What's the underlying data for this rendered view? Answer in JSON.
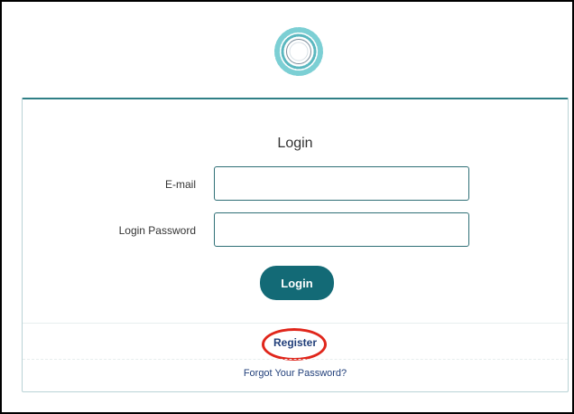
{
  "header": {
    "logo_icon": "circular-logo-icon"
  },
  "login": {
    "title": "Login",
    "email_label": "E-mail",
    "email_value": "",
    "password_label": "Login Password",
    "password_value": "",
    "submit_label": "Login"
  },
  "links": {
    "register": "Register",
    "forgot_password": "Forgot Your Password?"
  },
  "colors": {
    "primary": "#136a76",
    "border": "#2f6f76",
    "link": "#213f7a",
    "highlight": "#e0261b"
  }
}
